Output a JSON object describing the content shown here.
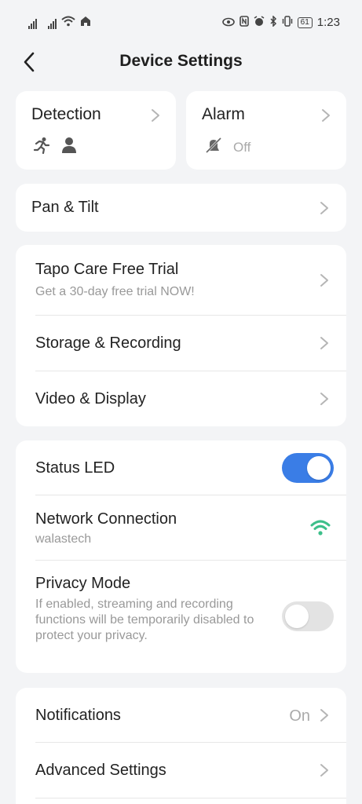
{
  "status_bar": {
    "time": "1:23",
    "battery": "61"
  },
  "header": {
    "title": "Device Settings"
  },
  "tiles": {
    "detection": {
      "label": "Detection"
    },
    "alarm": {
      "label": "Alarm",
      "status": "Off"
    }
  },
  "pan_tilt": {
    "label": "Pan & Tilt"
  },
  "group1": {
    "care": {
      "label": "Tapo Care Free Trial",
      "subtitle": "Get a 30-day free trial NOW!"
    },
    "storage": {
      "label": "Storage & Recording"
    },
    "video": {
      "label": "Video & Display"
    }
  },
  "group2": {
    "status_led": {
      "label": "Status LED",
      "enabled": true
    },
    "network": {
      "label": "Network Connection",
      "ssid": "walastech"
    },
    "privacy": {
      "label": "Privacy Mode",
      "description": "If enabled, streaming and recording functions will be temporarily disabled to protect your privacy.",
      "enabled": false
    }
  },
  "group3": {
    "notifications": {
      "label": "Notifications",
      "value": "On"
    },
    "advanced": {
      "label": "Advanced Settings"
    }
  },
  "colors": {
    "accent": "#3a7de6",
    "wifi": "#3dbf8a",
    "background": "#f3f4f6"
  }
}
